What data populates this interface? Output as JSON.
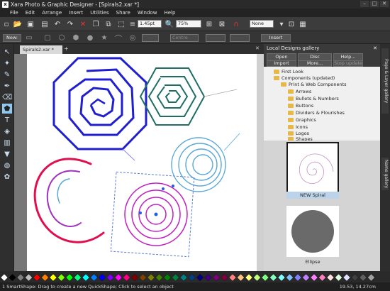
{
  "app": {
    "title": "Xara Photo & Graphic Designer - [Spirals2.xar *]",
    "icon_letter": "x"
  },
  "window_controls": [
    "–",
    "□",
    "✕"
  ],
  "menu": [
    "File",
    "Edit",
    "Arrange",
    "Insert",
    "Utilities",
    "Share",
    "Window",
    "Help"
  ],
  "toolbar": {
    "line_width": "1.45pt",
    "zoom": "75%",
    "none_field": "None",
    "new_label": "New:",
    "insert_button": "Insert",
    "centre_field": "Centre"
  },
  "doc_tab": {
    "label": "Spirals2.xar *",
    "close": "✕",
    "add": "+"
  },
  "gallery": {
    "title": "Local Designs gallery",
    "buttons": [
      "Open",
      "Disc designs...",
      "Help..."
    ],
    "buttons2": [
      "Import",
      "More...",
      "Stop update"
    ],
    "tree": [
      {
        "label": "First Look",
        "level": 0
      },
      {
        "label": "Components (updated)",
        "level": 0
      },
      {
        "label": "Print & Web Components",
        "level": 1
      },
      {
        "label": "Arrows",
        "level": 2
      },
      {
        "label": "Bullets & Numbers",
        "level": 2
      },
      {
        "label": "Buttons",
        "level": 2
      },
      {
        "label": "Dividers & Flourishes",
        "level": 2
      },
      {
        "label": "Graphics",
        "level": 2
      },
      {
        "label": "Icons",
        "level": 2
      },
      {
        "label": "Logos",
        "level": 2
      },
      {
        "label": "Shapes",
        "level": 2
      }
    ],
    "thumb1_label": "NEW Spiral",
    "thumb2_label": "Ellipse"
  },
  "side_tabs": [
    "Page & Layer gallery",
    "Name gallery"
  ],
  "status": {
    "hint": "1 SmartShape: Drag to create a new QuickShape; Click to select an object",
    "coords": "19.53, 14.27cm"
  },
  "colors": {
    "accent_selected": "#8fc8f0",
    "spiral_blue": "#1f1fd0",
    "spiral_teal": "#1f6e66",
    "spiral_magenta": "#c020c0",
    "spiral_lightblue": "#5aa8d8"
  },
  "palette": [
    "#ffffff",
    "#000000",
    "#7f7f7f",
    "#c0c0c0",
    "#ff0000",
    "#ff8000",
    "#ffff00",
    "#80ff00",
    "#00ff00",
    "#00ff80",
    "#00ffff",
    "#0080ff",
    "#0000ff",
    "#8000ff",
    "#ff00ff",
    "#ff0080",
    "#800000",
    "#804000",
    "#808000",
    "#408000",
    "#008000",
    "#008040",
    "#008080",
    "#004080",
    "#000080",
    "#400080",
    "#800080",
    "#800040",
    "#ff8080",
    "#ffc080",
    "#ffff80",
    "#c0ff80",
    "#80ff80",
    "#80ffc0",
    "#80ffff",
    "#80c0ff",
    "#8080ff",
    "#c080ff",
    "#ff80ff",
    "#ff80c0",
    "#ffe0e0",
    "#e0ffe0",
    "#e0e0ff",
    "#404040",
    "#606060",
    "#a0a0a0"
  ]
}
